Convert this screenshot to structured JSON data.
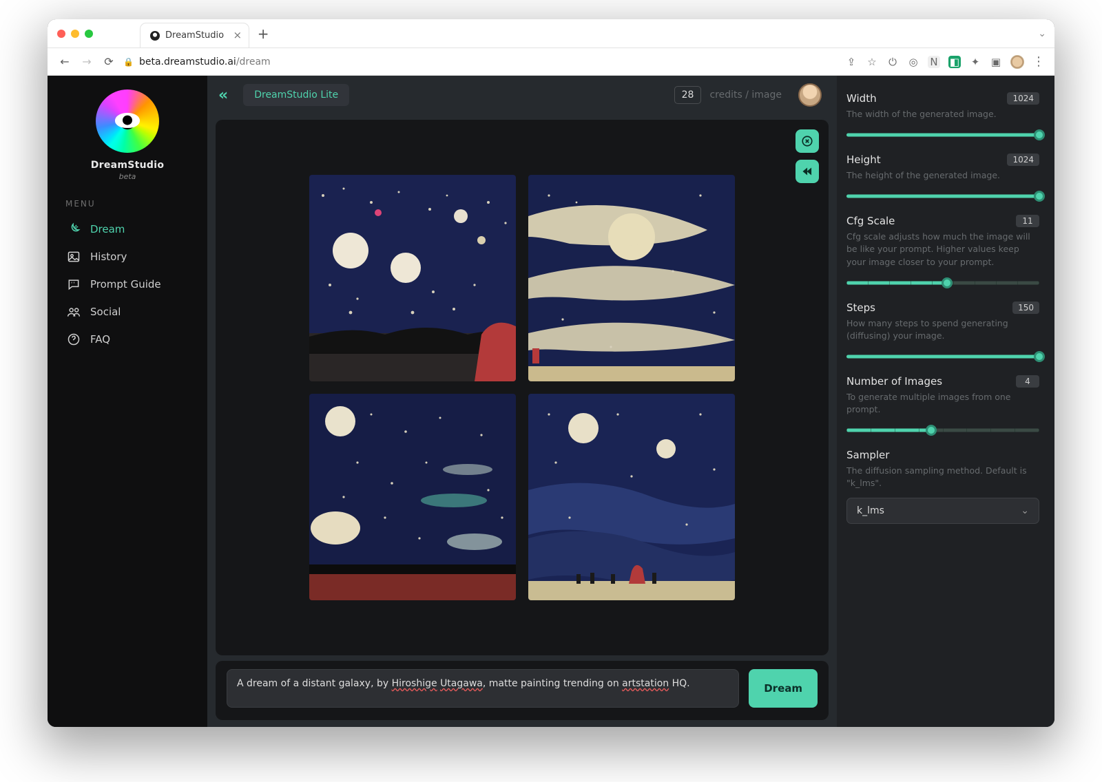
{
  "browser": {
    "tab_title": "DreamStudio",
    "url_host": "beta.dreamstudio.ai",
    "url_path": "/dream"
  },
  "sidebar": {
    "brand": "DreamStudio",
    "brand_sub": "beta",
    "menu_header": "MENU",
    "items": [
      {
        "label": "Dream",
        "active": true
      },
      {
        "label": "History",
        "active": false
      },
      {
        "label": "Prompt Guide",
        "active": false
      },
      {
        "label": "Social",
        "active": false
      },
      {
        "label": "FAQ",
        "active": false
      }
    ]
  },
  "topbar": {
    "lite_label": "DreamStudio Lite",
    "credits_value": "28",
    "credits_label": "credits / image"
  },
  "prompt": {
    "text_prefix": "A dream of a distant galaxy, by ",
    "underline1": "Hiroshige",
    "sep1": " ",
    "underline2": "Utagawa",
    "mid": ", matte painting trending on ",
    "underline3": "artstation",
    "suffix": " HQ.",
    "button": "Dream"
  },
  "settings": {
    "width": {
      "title": "Width",
      "value": "1024",
      "desc": "The width of the generated image.",
      "fill": 100
    },
    "height": {
      "title": "Height",
      "value": "1024",
      "desc": "The height of the generated image.",
      "fill": 100
    },
    "cfg": {
      "title": "Cfg Scale",
      "value": "11",
      "desc": "Cfg scale adjusts how much the image will be like your prompt. Higher values keep your image closer to your prompt.",
      "fill": 52
    },
    "steps": {
      "title": "Steps",
      "value": "150",
      "desc": "How many steps to spend generating (diffusing) your image.",
      "fill": 100
    },
    "num": {
      "title": "Number of Images",
      "value": "4",
      "desc": "To generate multiple images from one prompt.",
      "fill": 44
    },
    "sampler": {
      "title": "Sampler",
      "desc": "The diffusion sampling method. Default is \"k_lms\".",
      "selected": "k_lms"
    }
  }
}
